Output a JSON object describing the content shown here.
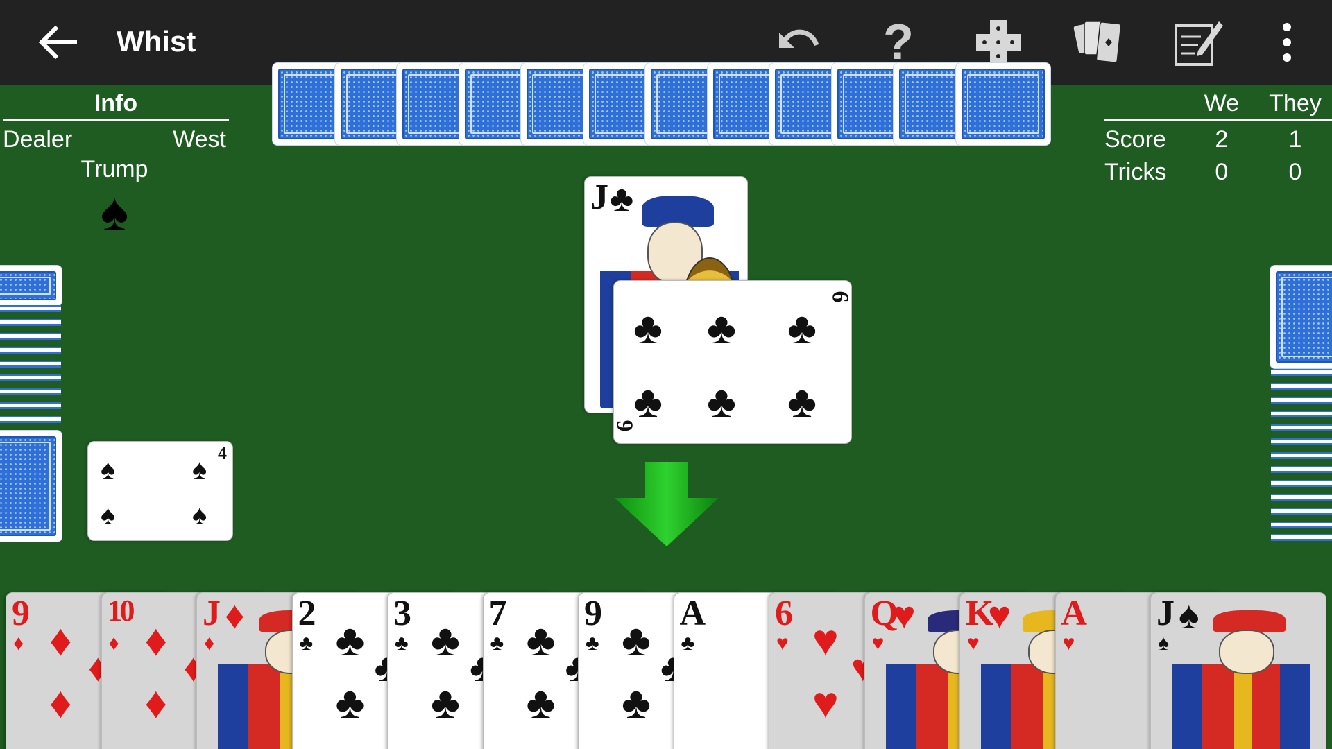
{
  "app": {
    "title": "Whist"
  },
  "toolbar": {
    "back_icon": "arrow-left-icon",
    "undo_icon": "undo-icon",
    "help_label": "?",
    "icons": [
      "undo-icon",
      "help-icon",
      "puzzle-icon",
      "cards-icon",
      "notepad-icon",
      "more-vert-icon"
    ]
  },
  "info": {
    "header": "Info",
    "dealer_label": "Dealer",
    "dealer_value": "West",
    "trump_label": "Trump",
    "trump_suit": "♠"
  },
  "score": {
    "col_we": "We",
    "col_they": "They",
    "rows": [
      {
        "label": "Score",
        "we": "2",
        "they": "1"
      },
      {
        "label": "Tricks",
        "we": "0",
        "they": "0"
      }
    ]
  },
  "north_hand": {
    "count": 12
  },
  "trick": {
    "west": {
      "rank": "4",
      "suit": "♠",
      "color": "black"
    },
    "north": {
      "rank": "J",
      "suit": "♣",
      "color": "black"
    },
    "center": {
      "rank": "6",
      "suit": "♣",
      "color": "black"
    }
  },
  "player_hand": [
    {
      "rank": "9",
      "suit": "♦",
      "color": "red",
      "playable": false
    },
    {
      "rank": "10",
      "suit": "♦",
      "color": "red",
      "playable": false
    },
    {
      "rank": "J",
      "suit": "♦",
      "color": "red",
      "playable": false
    },
    {
      "rank": "2",
      "suit": "♣",
      "color": "black",
      "playable": true
    },
    {
      "rank": "3",
      "suit": "♣",
      "color": "black",
      "playable": true
    },
    {
      "rank": "7",
      "suit": "♣",
      "color": "black",
      "playable": true
    },
    {
      "rank": "9",
      "suit": "♣",
      "color": "black",
      "playable": true
    },
    {
      "rank": "A",
      "suit": "♣",
      "color": "black",
      "playable": true
    },
    {
      "rank": "6",
      "suit": "♥",
      "color": "red",
      "playable": false
    },
    {
      "rank": "Q",
      "suit": "♥",
      "color": "red",
      "playable": false
    },
    {
      "rank": "K",
      "suit": "♥",
      "color": "red",
      "playable": false
    },
    {
      "rank": "A",
      "suit": "♥",
      "color": "red",
      "playable": false
    },
    {
      "rank": "J",
      "suit": "♠",
      "color": "black",
      "playable": false
    }
  ],
  "colors": {
    "table": "#1f5c22",
    "toolbar": "#222222",
    "card_back": "#2e6fd8",
    "arrow": "#12b312"
  }
}
